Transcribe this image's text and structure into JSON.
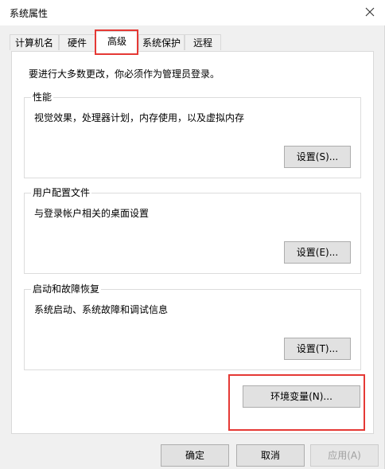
{
  "window": {
    "title": "系统属性"
  },
  "tabs": [
    {
      "label": "计算机名"
    },
    {
      "label": "硬件"
    },
    {
      "label": "高级",
      "active": true
    },
    {
      "label": "系统保护"
    },
    {
      "label": "远程"
    }
  ],
  "admin_note": "要进行大多数更改，你必须作为管理员登录。",
  "groups": {
    "performance": {
      "title": "性能",
      "description": "视觉效果，处理器计划，内存使用，以及虚拟内存",
      "button": "设置(S)..."
    },
    "user_profiles": {
      "title": "用户配置文件",
      "description": "与登录帐户相关的桌面设置",
      "button": "设置(E)..."
    },
    "startup_recovery": {
      "title": "启动和故障恢复",
      "description": "系统启动、系统故障和调试信息",
      "button": "设置(T)..."
    }
  },
  "env_button": "环境变量(N)...",
  "footer": {
    "ok": "确定",
    "cancel": "取消",
    "apply": "应用(A)"
  },
  "colors": {
    "highlight_box": "#e53935",
    "dialog_bg": "#f0f0f0",
    "panel_bg": "#ffffff"
  }
}
